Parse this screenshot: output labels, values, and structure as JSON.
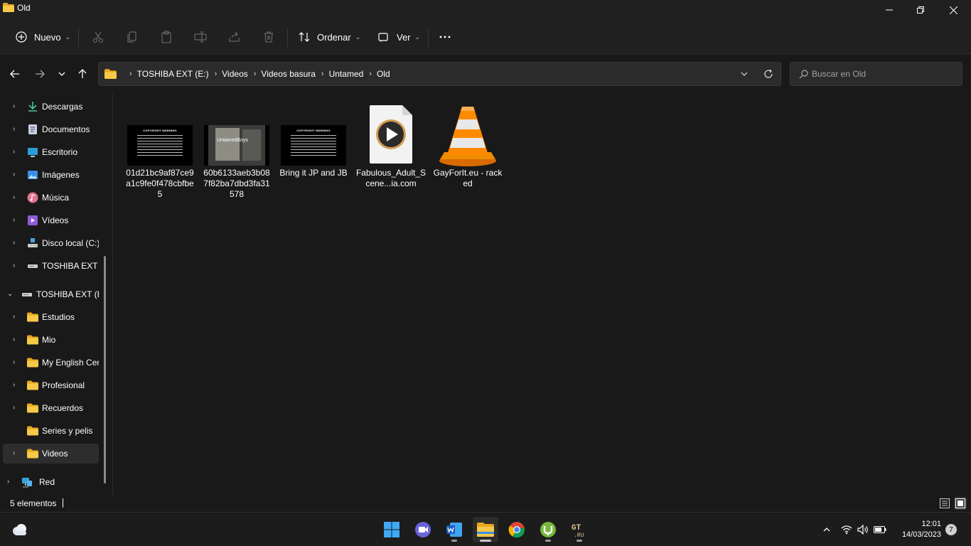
{
  "window": {
    "title": "Old"
  },
  "toolbar": {
    "new_label": "Nuevo",
    "sort_label": "Ordenar",
    "view_label": "Ver"
  },
  "address": {
    "crumbs": [
      "TOSHIBA EXT (E:)",
      "Videos",
      "Videos basura",
      "Untamed",
      "Old"
    ]
  },
  "search": {
    "placeholder": "Buscar en Old"
  },
  "sidebar": {
    "items": [
      {
        "label": "Descargas",
        "icon": "download-icon"
      },
      {
        "label": "Documentos",
        "icon": "documents-icon"
      },
      {
        "label": "Escritorio",
        "icon": "desktop-icon"
      },
      {
        "label": "Imágenes",
        "icon": "pictures-icon"
      },
      {
        "label": "Música",
        "icon": "music-icon"
      },
      {
        "label": "Vídeos",
        "icon": "videos-icon"
      },
      {
        "label": "Disco local (C:)",
        "icon": "drive-icon"
      },
      {
        "label": "TOSHIBA EXT (E:)",
        "icon": "external-drive-icon"
      },
      {
        "label": "TOSHIBA EXT (E:)",
        "icon": "external-drive-icon"
      },
      {
        "label": "Estudios",
        "icon": "folder-icon"
      },
      {
        "label": "Mio",
        "icon": "folder-icon"
      },
      {
        "label": "My English Center",
        "icon": "folder-icon"
      },
      {
        "label": "Profesional",
        "icon": "folder-icon"
      },
      {
        "label": "Recuerdos",
        "icon": "folder-icon"
      },
      {
        "label": "Series y pelis",
        "icon": "folder-icon"
      },
      {
        "label": "Videos",
        "icon": "folder-icon"
      },
      {
        "label": "Red",
        "icon": "network-icon"
      }
    ]
  },
  "files": [
    {
      "name": "01d21bc9af87ce9a1c9fe0f478cbfbe5",
      "thumb_title": "COPYRIGHT WARNING"
    },
    {
      "name": "60b6133aeb3b087f82ba7dbd3fa31578",
      "thumb_text": "UntamedBoys"
    },
    {
      "name": "Bring it JP and JB",
      "thumb_title": "COPYRIGHT WARNING"
    },
    {
      "name": "Fabulous_Adult_Scene...ia.com"
    },
    {
      "name": "GayForIt.eu - racked"
    }
  ],
  "status": {
    "count": "5 elementos"
  },
  "taskbar": {
    "time": "12:01",
    "date": "14/03/2023",
    "notifications": "7"
  },
  "colors": {
    "accent": "#f0b429",
    "background": "#191919",
    "chrome": "#202020"
  }
}
